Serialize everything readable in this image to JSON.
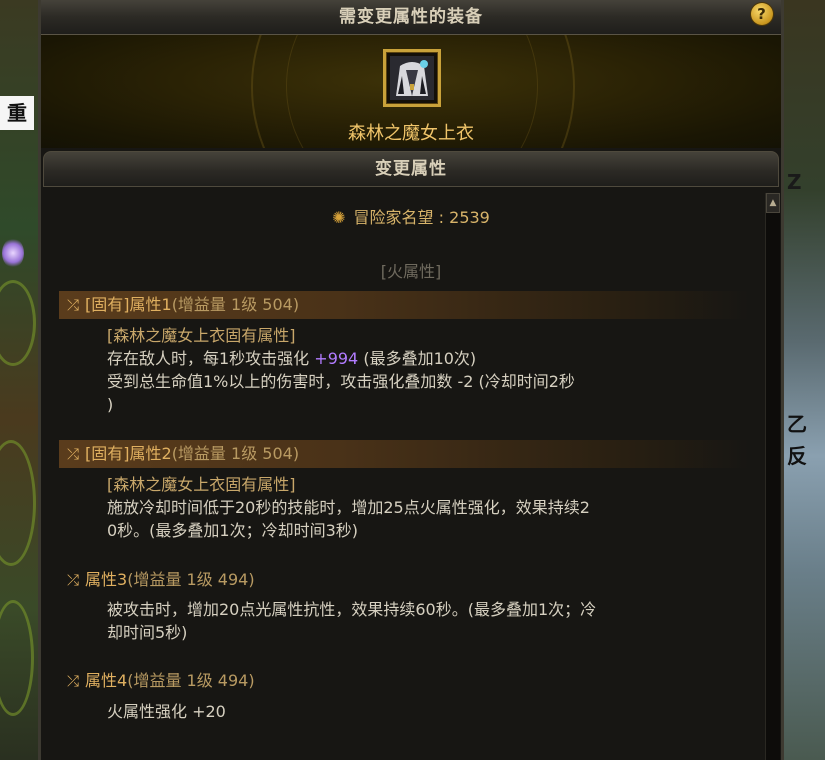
{
  "background": {
    "left_sign": "重",
    "right_text_1": "Z",
    "right_text_2": "乙",
    "right_text_3": "反"
  },
  "header": {
    "title": "需变更属性的装备",
    "help_label": "?"
  },
  "equipment": {
    "name": "森林之魔女上衣",
    "icon": "witch-coat-icon"
  },
  "section": {
    "title": "变更属性"
  },
  "reputation": {
    "label": "冒险家名望",
    "separator": ":",
    "value": "2539"
  },
  "element_tag": "[火属性]",
  "attributes": [
    {
      "title": "[固有]属性1",
      "detail": "(增益量 1级 504)",
      "source": "[森林之魔女上衣固有属性]",
      "line1_pre": "存在敌人时，每1秒攻击强化 ",
      "line1_val": "+994",
      "line1_post": " (最多叠加10次)",
      "line2": "受到总生命值1%以上的伤害时，攻击强化叠加数 -2 (冷却时间2秒",
      "line3": ")"
    },
    {
      "title": "[固有]属性2",
      "detail": "(增益量 1级 504)",
      "source": "[森林之魔女上衣固有属性]",
      "line1": "施放冷却时间低于20秒的技能时，增加25点火属性强化，效果持续2",
      "line2": "0秒。(最多叠加1次；冷却时间3秒)"
    },
    {
      "title": "属性3",
      "detail": "(增益量 1级 494)",
      "line1": "被攻击时，增加20点光属性抗性，效果持续60秒。(最多叠加1次；冷",
      "line2": "却时间5秒)"
    },
    {
      "title": "属性4",
      "detail": "(增益量 1级 494)",
      "line1": "火属性强化 +20"
    }
  ],
  "colors": {
    "gold_text": "#e0b060",
    "value_purple": "#b27cff",
    "item_name": "#f0c56a"
  }
}
